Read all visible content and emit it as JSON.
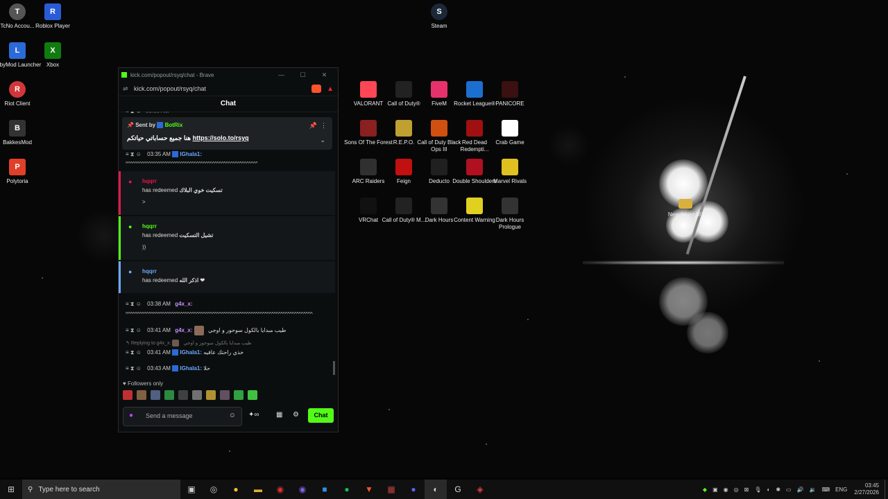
{
  "desktop_left": [
    {
      "label": "TcNo Accou...",
      "icon": "tcno-icon",
      "color": "#444"
    },
    {
      "label": "Roblox Player",
      "icon": "roblox-icon",
      "color": "#2a5bd7"
    },
    {
      "label": "LabyMod Launcher",
      "icon": "labymod-icon",
      "color": "#2a6bd7"
    },
    {
      "label": "Xbox",
      "icon": "xbox-icon",
      "color": "#107c10"
    },
    {
      "label": "Riot Client",
      "icon": "riot-icon",
      "color": "#d13639"
    },
    {
      "label": "BakkesMod",
      "icon": "bakkesmod-icon",
      "color": "#333"
    },
    {
      "label": "Polytoria",
      "icon": "polytoria-icon",
      "color": "#e0402a"
    },
    {
      "label": "Steam",
      "icon": "steam-icon",
      "color": "#1b2838"
    }
  ],
  "desktop_grid": [
    {
      "label": "VALORANT",
      "color": "#ff4655"
    },
    {
      "label": "Call of Duty®",
      "color": "#222"
    },
    {
      "label": "FiveM",
      "color": "#e6326b"
    },
    {
      "label": "Rocket League®",
      "color": "#1c6fd1"
    },
    {
      "label": "PANICORE",
      "color": "#3a1010"
    },
    {
      "label": "Sons Of The Forest",
      "color": "#8a2020"
    },
    {
      "label": "R.E.P.O.",
      "color": "#c0a030"
    },
    {
      "label": "Call of Duty Black Ops III",
      "color": "#d05010"
    },
    {
      "label": "Red Dead Redempti...",
      "color": "#a01010"
    },
    {
      "label": "Crab Game",
      "color": "#ffffff"
    },
    {
      "label": "ARC Raiders",
      "color": "#303030"
    },
    {
      "label": "Feign",
      "color": "#c01010"
    },
    {
      "label": "Deducto",
      "color": "#202020"
    },
    {
      "label": "Double Shoulders",
      "color": "#b01020"
    },
    {
      "label": "Marvel Rivals",
      "color": "#e0c020"
    },
    {
      "label": "VRChat",
      "color": "#111"
    },
    {
      "label": "Call of Duty® M...",
      "color": "#222"
    },
    {
      "label": "Dark Hours",
      "color": "#333"
    },
    {
      "label": "Content Warning",
      "color": "#e0d020"
    },
    {
      "label": "Dark Hours Prologue",
      "color": "#333"
    }
  ],
  "desktop_folder": {
    "label": "New folder (8)"
  },
  "browser": {
    "title": "kick.com/popout/rsyq/chat - Brave",
    "url": "kick.com/popout/rsyq/chat",
    "minimize": "—",
    "maximize": "☐",
    "close": "✕"
  },
  "chat": {
    "header": "Chat",
    "pinned": {
      "sent_by": "Sent by",
      "author": "BotRix",
      "text": "هنا جميع حساباتي حياتكم",
      "link": "https://solo.to/rsyq"
    },
    "msg1": {
      "time": "03:35 AM",
      "user": "IGhala1:",
      "body": "^^^^^^^^^^^^^^^^^^^^^^^^^^^^^^^^^^^^^^^^^^^^^^^^^^^^^^^^^^^^^^^^^^^^^^^^^^^^^^^^^^^^^^^^^^^^^^^^^^^^^"
    },
    "redeem1": {
      "user": "hqqrr",
      "action": "has redeemed",
      "reward": "تسكيت خوي البلاك",
      "note": ">"
    },
    "redeem2": {
      "user": "hqqrr",
      "action": "has redeemed",
      "reward": "تشيل التسكيت",
      "note": "))"
    },
    "redeem3": {
      "user": "hqqrr",
      "action": "has redeemed",
      "reward": "اذكر الله ❤"
    },
    "msg2": {
      "time": "03:38 AM",
      "user": "g4x_x:",
      "body": "^^^^^^^^^^^^^^^^^^^^^^^^^^^^^^^^^^^^^^^^^^^^^^^^^^^^^^^^^^^^^^^^^^^^^^^^^^^^^^^^^^^^^^^^^^^^^^^^^^^^^^^^^^^^^^^^^^^^"
    },
    "msg3": {
      "time": "03:41 AM",
      "user": "g4x_x:",
      "body": "طيب مبدايا بالكول سوحور و اوجي"
    },
    "reply": {
      "prefix": "Replying to g4x_x:",
      "quoted": "طيب مبدايا بالكول سوحور و اوجي"
    },
    "msg4": {
      "time": "03:41 AM",
      "user": "IGhala1:",
      "body": "خذي راحتك عافيه"
    },
    "msg5": {
      "time": "03:43 AM",
      "user": "IGhala1:",
      "body": "حلا"
    },
    "followers_only": "Followers only",
    "input_placeholder": "Send a message",
    "chat_button": "Chat"
  },
  "taskbar": {
    "search_placeholder": "Type here to search",
    "lang": "ENG",
    "time": "03:45",
    "date": "2/27/2026"
  }
}
